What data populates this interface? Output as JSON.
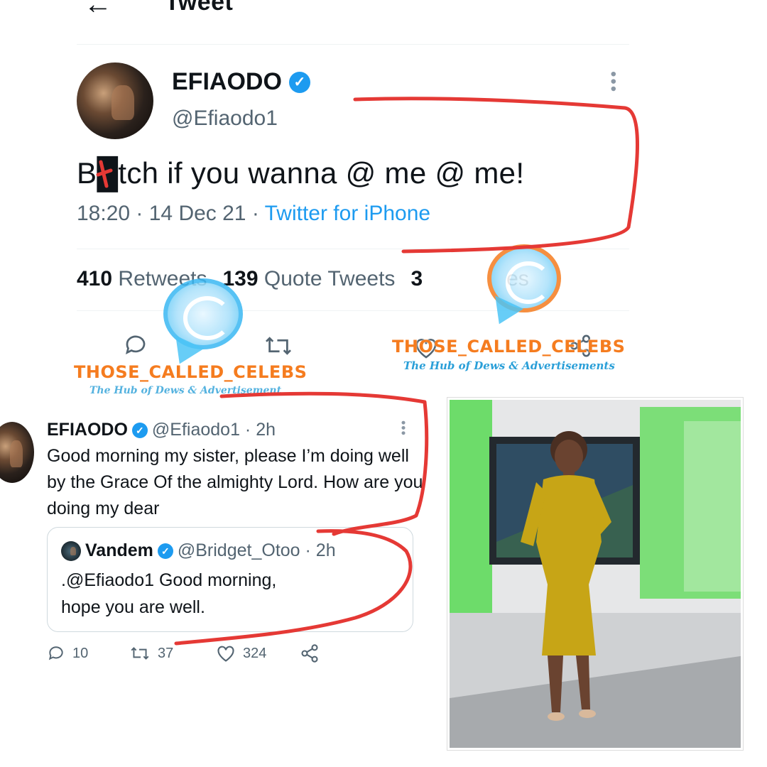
{
  "header": {
    "back_icon": "arrow-left-icon",
    "title": "Tweet"
  },
  "main_tweet": {
    "name": "EFIAODO",
    "handle": "@Efiaodo1",
    "text": "B█tch if you wanna @ me @ me!",
    "time": "18:20 · 14 Dec 21 ·",
    "source": "Twitter for iPhone",
    "retweets_count": "410",
    "retweets_label": "Retweets",
    "quotes_count": "139",
    "quotes_label": "Quote Tweets",
    "likes_count": "3",
    "likes_label_partial": "es"
  },
  "watermark": {
    "brand": "THOSE_CALLED_CELEBS",
    "tagline_left": "The Hub of Dews & Advertisement",
    "tagline_right": "The Hub of Dews & Advertisements"
  },
  "reply_tweet": {
    "name": "EFIAODO",
    "handle_time": "@Efiaodo1 · 2h",
    "text": "Good morning my sister, please I’m doing well by the Grace Of the almighty  Lord. How are you doing my dear",
    "quoted": {
      "name": "Vandem",
      "handle_time": "@Bridget_Otoo · 2h",
      "text_line1": ".@Efiaodo1 Good morning,",
      "text_line2": "hope you are well."
    },
    "replies": "10",
    "retweets": "37",
    "likes": "324"
  },
  "colors": {
    "accent": "#1d9bf0",
    "annotation": "#e53935",
    "watermark_orange": "#f57c1f",
    "watermark_blue": "#2a9fd8"
  }
}
